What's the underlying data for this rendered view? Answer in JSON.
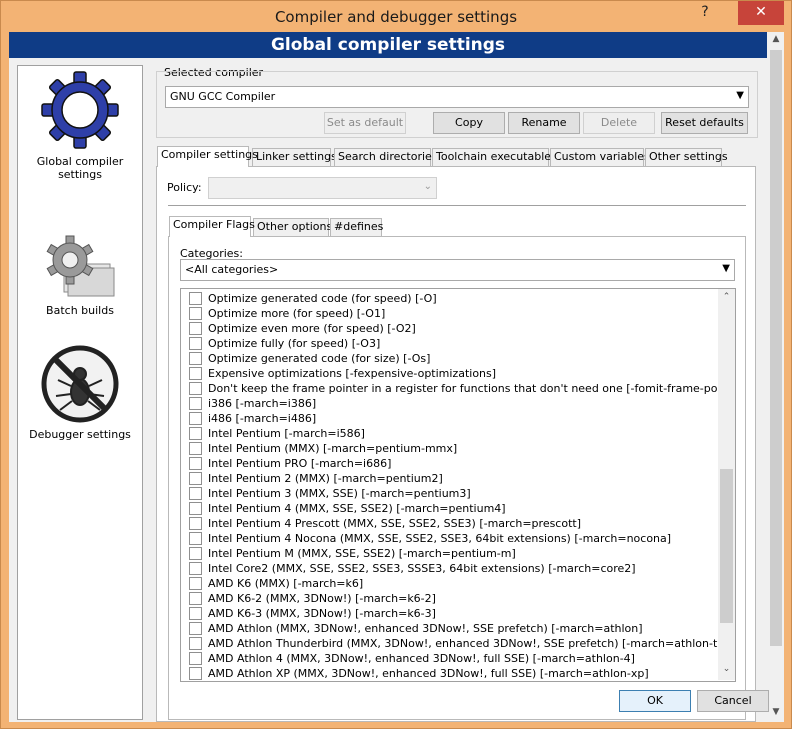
{
  "window": {
    "title": "Compiler and debugger settings",
    "help_glyph": "?",
    "close_glyph": "✕"
  },
  "banner": "Global compiler settings",
  "nav": [
    {
      "label": "Global compiler settings",
      "icon": "gear-icon"
    },
    {
      "label": "Batch builds",
      "icon": "batch-gears-icon"
    },
    {
      "label": "Debugger settings",
      "icon": "no-bug-icon"
    }
  ],
  "compiler": {
    "group_label": "Selected compiler",
    "selected": "GNU GCC Compiler",
    "buttons": {
      "set_default": "Set as default",
      "copy": "Copy",
      "rename": "Rename",
      "delete": "Delete",
      "reset": "Reset defaults"
    }
  },
  "tabs": [
    "Compiler settings",
    "Linker settings",
    "Search directories",
    "Toolchain executables",
    "Custom variables",
    "Other settings"
  ],
  "policy": {
    "label": "Policy:",
    "value": ""
  },
  "subtabs": [
    "Compiler Flags",
    "Other options",
    "#defines"
  ],
  "categories": {
    "label": "Categories:",
    "value": "<All categories>"
  },
  "flags": [
    "Optimize generated code (for speed)  [-O]",
    "Optimize more (for speed)  [-O1]",
    "Optimize even more (for speed)  [-O2]",
    "Optimize fully (for speed)  [-O3]",
    "Optimize generated code (for size)  [-Os]",
    "Expensive optimizations  [-fexpensive-optimizations]",
    "Don't keep the frame pointer in a register for functions that don't need one  [-fomit-frame-pointer]",
    "i386  [-march=i386]",
    "i486  [-march=i486]",
    "Intel Pentium  [-march=i586]",
    "Intel Pentium (MMX)  [-march=pentium-mmx]",
    "Intel Pentium PRO  [-march=i686]",
    "Intel Pentium 2 (MMX)  [-march=pentium2]",
    "Intel Pentium 3 (MMX, SSE)  [-march=pentium3]",
    "Intel Pentium 4 (MMX, SSE, SSE2)  [-march=pentium4]",
    "Intel Pentium 4 Prescott (MMX, SSE, SSE2, SSE3)  [-march=prescott]",
    "Intel Pentium 4 Nocona (MMX, SSE, SSE2, SSE3, 64bit extensions)  [-march=nocona]",
    "Intel Pentium M (MMX, SSE, SSE2)  [-march=pentium-m]",
    "Intel Core2 (MMX, SSE, SSE2, SSE3, SSSE3, 64bit extensions)  [-march=core2]",
    "AMD K6 (MMX)  [-march=k6]",
    "AMD K6-2 (MMX, 3DNow!)  [-march=k6-2]",
    "AMD K6-3 (MMX, 3DNow!)  [-march=k6-3]",
    "AMD Athlon (MMX, 3DNow!, enhanced 3DNow!, SSE prefetch)  [-march=athlon]",
    "AMD Athlon Thunderbird (MMX, 3DNow!, enhanced 3DNow!, SSE prefetch)  [-march=athlon-tbird]",
    "AMD Athlon 4 (MMX, 3DNow!, enhanced 3DNow!, full SSE)  [-march=athlon-4]",
    "AMD Athlon XP (MMX, 3DNow!, enhanced 3DNow!, full SSE)  [-march=athlon-xp]"
  ],
  "footer": {
    "ok": "OK",
    "cancel": "Cancel"
  },
  "colors": {
    "banner": "#0f3c86",
    "title_bar": "#f3b374",
    "close": "#c7443a"
  }
}
